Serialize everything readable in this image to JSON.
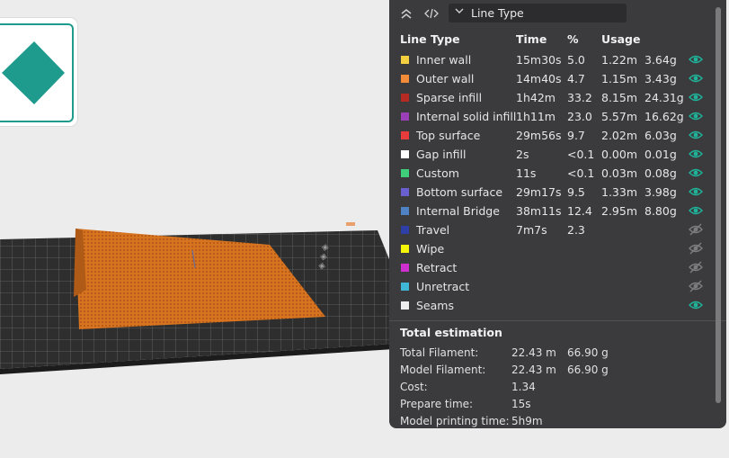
{
  "toolbar": {
    "collapse_icon": "double-chevron-up-icon",
    "code_icon": "code-icon",
    "selector_value": "Line Type"
  },
  "headers": {
    "line_type": "Line Type",
    "time": "Time",
    "percent": "%",
    "usage": "Usage"
  },
  "rows": [
    {
      "name": "Inner wall",
      "color": "#f4d03f",
      "time": "15m30s",
      "percent": "5.0",
      "length": "1.22m",
      "weight": "3.64g",
      "visible": true
    },
    {
      "name": "Outer wall",
      "color": "#f28c38",
      "time": "14m40s",
      "percent": "4.7",
      "length": "1.15m",
      "weight": "3.43g",
      "visible": true
    },
    {
      "name": "Sparse infill",
      "color": "#b52a22",
      "time": "1h42m",
      "percent": "33.2",
      "length": "8.15m",
      "weight": "24.31g",
      "visible": true
    },
    {
      "name": "Internal solid infill",
      "color": "#9b3fb8",
      "time": "1h11m",
      "percent": "23.0",
      "length": "5.57m",
      "weight": "16.62g",
      "visible": true
    },
    {
      "name": "Top surface",
      "color": "#e83b3b",
      "time": "29m56s",
      "percent": "9.7",
      "length": "2.02m",
      "weight": "6.03g",
      "visible": true
    },
    {
      "name": "Gap infill",
      "color": "#ffffff",
      "time": "2s",
      "percent": "<0.1",
      "length": "0.00m",
      "weight": "0.01g",
      "visible": true
    },
    {
      "name": "Custom",
      "color": "#3fce7a",
      "time": "11s",
      "percent": "<0.1",
      "length": "0.03m",
      "weight": "0.08g",
      "visible": true
    },
    {
      "name": "Bottom surface",
      "color": "#6a5fd0",
      "time": "29m17s",
      "percent": "9.5",
      "length": "1.33m",
      "weight": "3.98g",
      "visible": true
    },
    {
      "name": "Internal Bridge",
      "color": "#4f82c4",
      "time": "38m11s",
      "percent": "12.4",
      "length": "2.95m",
      "weight": "8.80g",
      "visible": true
    },
    {
      "name": "Travel",
      "color": "#2f3fa8",
      "time": "7m7s",
      "percent": "2.3",
      "length": "",
      "weight": "",
      "visible": false
    },
    {
      "name": "Wipe",
      "color": "#f5f50a",
      "time": "",
      "percent": "",
      "length": "",
      "weight": "",
      "visible": false
    },
    {
      "name": "Retract",
      "color": "#d02fd0",
      "time": "",
      "percent": "",
      "length": "",
      "weight": "",
      "visible": false
    },
    {
      "name": "Unretract",
      "color": "#3fb6d6",
      "time": "",
      "percent": "",
      "length": "",
      "weight": "",
      "visible": false
    },
    {
      "name": "Seams",
      "color": "#eeeeee",
      "time": "",
      "percent": "",
      "length": "",
      "weight": "",
      "visible": true
    }
  ],
  "total": {
    "title": "Total estimation",
    "rows": [
      {
        "label": "Total Filament:",
        "v1": "22.43 m",
        "v2": "66.90 g"
      },
      {
        "label": "Model Filament:",
        "v1": "22.43 m",
        "v2": "66.90 g"
      },
      {
        "label": "Cost:",
        "v1": "1.34",
        "v2": ""
      },
      {
        "label": "Prepare time:",
        "v1": "15s",
        "v2": ""
      },
      {
        "label": "Model printing time:",
        "v1": "5h9m",
        "v2": ""
      }
    ]
  },
  "colors": {
    "panel_bg": "#3b3b3d",
    "eye_visible": "#1fb39a",
    "eye_hidden": "#7d7d80",
    "plate": "#2e2e2e",
    "print": "#d8741f",
    "view_cube": "#1f9b8d"
  }
}
